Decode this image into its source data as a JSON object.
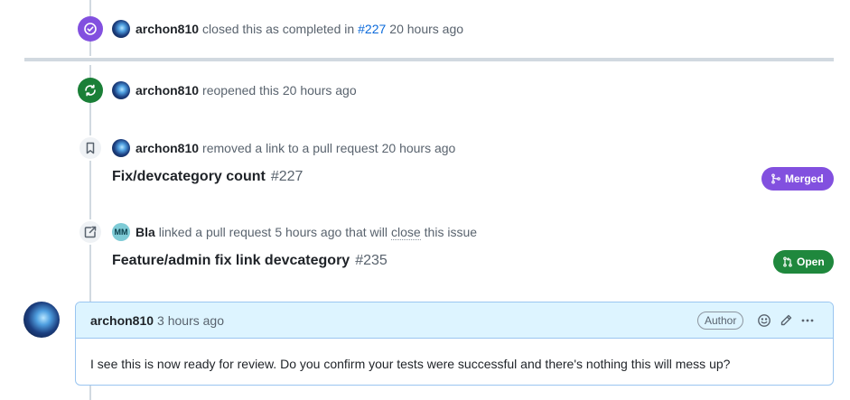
{
  "events": {
    "closed": {
      "actor": "archon810",
      "text": "closed this as completed in",
      "ref": "#227",
      "time": "20 hours ago",
      "icon": "check-circle-icon"
    },
    "reopened": {
      "actor": "archon810",
      "text": "reopened this",
      "time": "20 hours ago",
      "icon": "sync-icon"
    },
    "removed_link": {
      "actor": "archon810",
      "text": "removed a link to a pull request",
      "time": "20 hours ago",
      "icon": "bookmark-icon",
      "pr_title": "Fix/devcategory count",
      "pr_number": "#227",
      "pr_state": "Merged"
    },
    "linked": {
      "actor": "Bla",
      "actor_initials": "MM",
      "text_before": "linked a pull request",
      "time": "5 hours ago",
      "text_middle": "that will",
      "close_word": "close",
      "text_after": "this issue",
      "icon": "cross-reference-icon",
      "pr_title": "Feature/admin fix link devcategory",
      "pr_number": "#235",
      "pr_state": "Open"
    }
  },
  "comment": {
    "author": "archon810",
    "time": "3 hours ago",
    "role_label": "Author",
    "body": "I see this is now ready for review. Do you confirm your tests were successful and there's nothing this will mess up?"
  },
  "colors": {
    "done_purple": "#8250df",
    "open_green": "#1f883d",
    "link_blue": "#0969da",
    "comment_header_bg": "#ddf4ff"
  }
}
